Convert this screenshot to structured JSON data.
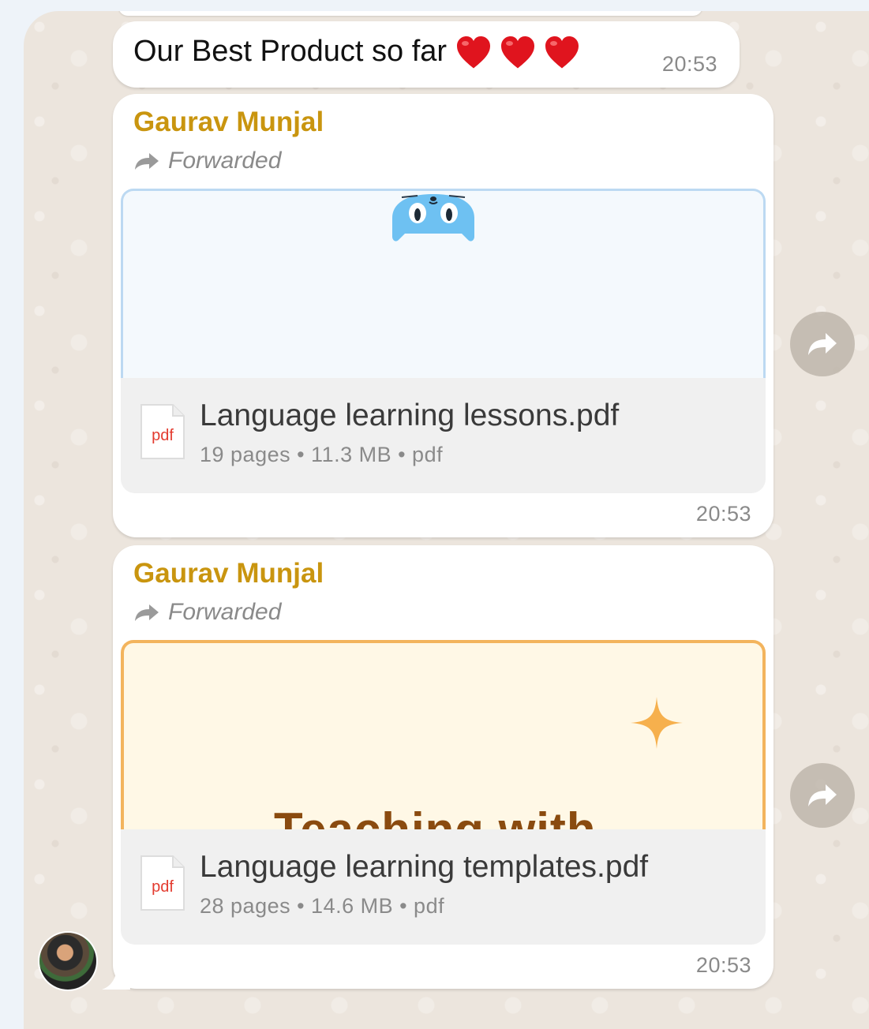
{
  "messages": {
    "text_message": {
      "text": "Our Best Product so far",
      "emoji": "❤️❤️❤️",
      "time": "20:53"
    },
    "documents": [
      {
        "sender": "Gaurav Munjal",
        "forwarded_label": "Forwarded",
        "file_icon_label": "pdf",
        "file_name": "Language learning lessons.pdf",
        "file_meta": "19 pages • 11.3 MB • pdf",
        "time": "20:53",
        "preview_accent": "#bcd9f2"
      },
      {
        "sender": "Gaurav Munjal",
        "forwarded_label": "Forwarded",
        "file_icon_label": "pdf",
        "file_name": "Language learning templates.pdf",
        "file_meta": "28 pages • 14.6 MB • pdf",
        "time": "20:53",
        "preview_title_partial": "Teaching with",
        "preview_accent": "#f3b45d"
      }
    ]
  },
  "colors": {
    "sender_name": "#c9950f",
    "chat_background": "#ece5dd",
    "bubble": "#ffffff",
    "pdf_red": "#e33b2f"
  },
  "icons": [
    "heart-icon",
    "forward-arrow-icon",
    "pdf-file-icon",
    "cat-illustration",
    "sparkle-icon",
    "share-forward-icon",
    "avatar"
  ]
}
